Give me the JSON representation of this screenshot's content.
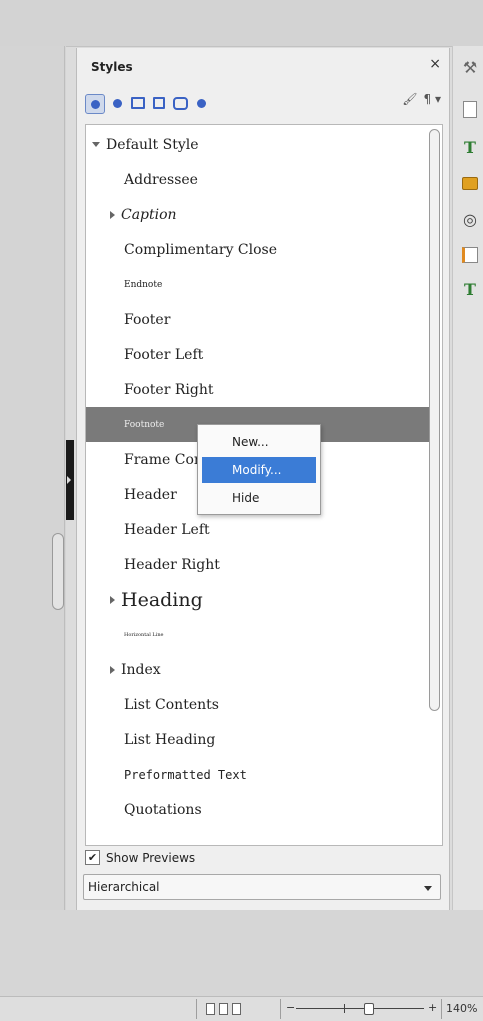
{
  "panel": {
    "title": "Styles",
    "close_glyph": "×",
    "style_families": [
      {
        "icon": "paragraph-styles-icon",
        "active": true
      },
      {
        "icon": "character-styles-icon",
        "active": false
      },
      {
        "icon": "frame-styles-icon",
        "active": false
      },
      {
        "icon": "page-styles-icon",
        "active": false
      },
      {
        "icon": "list-styles-icon",
        "active": false
      },
      {
        "icon": "table-styles-icon",
        "active": false
      }
    ],
    "fill_format_glyph": "🖌",
    "style_actions_glyph": "¶ ▾"
  },
  "styles": [
    {
      "label": "Default Style",
      "expander": "down",
      "level": 0,
      "size": 14
    },
    {
      "label": "Addressee",
      "level": 1,
      "size": 14
    },
    {
      "label": "Caption",
      "expander": "right",
      "level": 1,
      "size": 14,
      "italic": true
    },
    {
      "label": "Complimentary Close",
      "level": 1,
      "size": 14
    },
    {
      "label": "Endnote",
      "level": 1,
      "size": 9
    },
    {
      "label": "Footer",
      "level": 1,
      "size": 14
    },
    {
      "label": "Footer Left",
      "level": 1,
      "size": 14
    },
    {
      "label": "Footer Right",
      "level": 1,
      "size": 14
    },
    {
      "label": "Footnote",
      "level": 1,
      "size": 9,
      "selected": true
    },
    {
      "label": "Frame Contents",
      "level": 1,
      "size": 14
    },
    {
      "label": "Header",
      "level": 1,
      "size": 14
    },
    {
      "label": "Header Left",
      "level": 1,
      "size": 14
    },
    {
      "label": "Header Right",
      "level": 1,
      "size": 14
    },
    {
      "label": "Heading",
      "expander": "right",
      "level": 1,
      "size": 19
    },
    {
      "label": "Horizontal Line",
      "level": 1,
      "size": 5
    },
    {
      "label": "Index",
      "expander": "right",
      "level": 1,
      "size": 14
    },
    {
      "label": "List Contents",
      "level": 1,
      "size": 14
    },
    {
      "label": "List Heading",
      "level": 1,
      "size": 14
    },
    {
      "label": "Preformatted Text",
      "level": 1,
      "size": 12,
      "mono": true
    },
    {
      "label": "Quotations",
      "level": 1,
      "size": 14
    }
  ],
  "context_menu": {
    "items": [
      {
        "label": "New..."
      },
      {
        "label": "Modify...",
        "highlighted": true
      },
      {
        "label": "Hide"
      }
    ]
  },
  "footer": {
    "show_previews_label": "Show Previews",
    "show_previews_checked": true,
    "filter_value": "Hierarchical"
  },
  "statusbar": {
    "zoom_minus": "−",
    "zoom_plus": "+",
    "zoom_level": "140%"
  },
  "sidebar_icons": [
    "properties-icon",
    "page-icon",
    "styles-icon",
    "gallery-icon",
    "navigator-icon",
    "manage-changes-icon",
    "design-icon"
  ]
}
